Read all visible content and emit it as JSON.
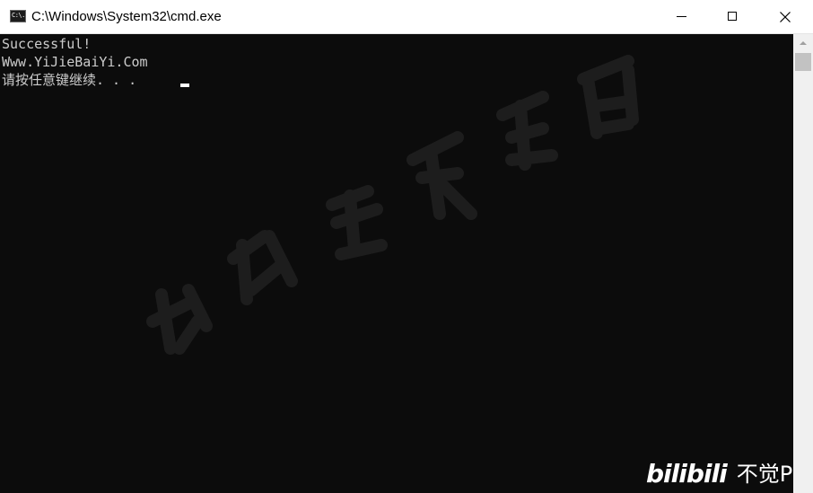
{
  "window": {
    "title": "C:\\Windows\\System32\\cmd.exe",
    "icon_text": "C:\\."
  },
  "console": {
    "lines": [
      "Successful!",
      "Www.YiJieBaiYi.Com",
      "请按任意键继续. . . "
    ]
  },
  "overlay": {
    "brand_logo": "bilibili",
    "brand_name": "不觉P"
  },
  "colors": {
    "console_background": "#0c0c0c",
    "console_text": "#cccccc",
    "titlebar_background": "#ffffff",
    "scrollbar_track": "#f0f0f0",
    "scrollbar_thumb": "#c2c2c2"
  },
  "icons": {
    "app": "cmd-icon",
    "minimize": "minimize-icon",
    "maximize": "maximize-icon",
    "close": "close-icon",
    "scroll_up": "arrow-up-icon"
  }
}
